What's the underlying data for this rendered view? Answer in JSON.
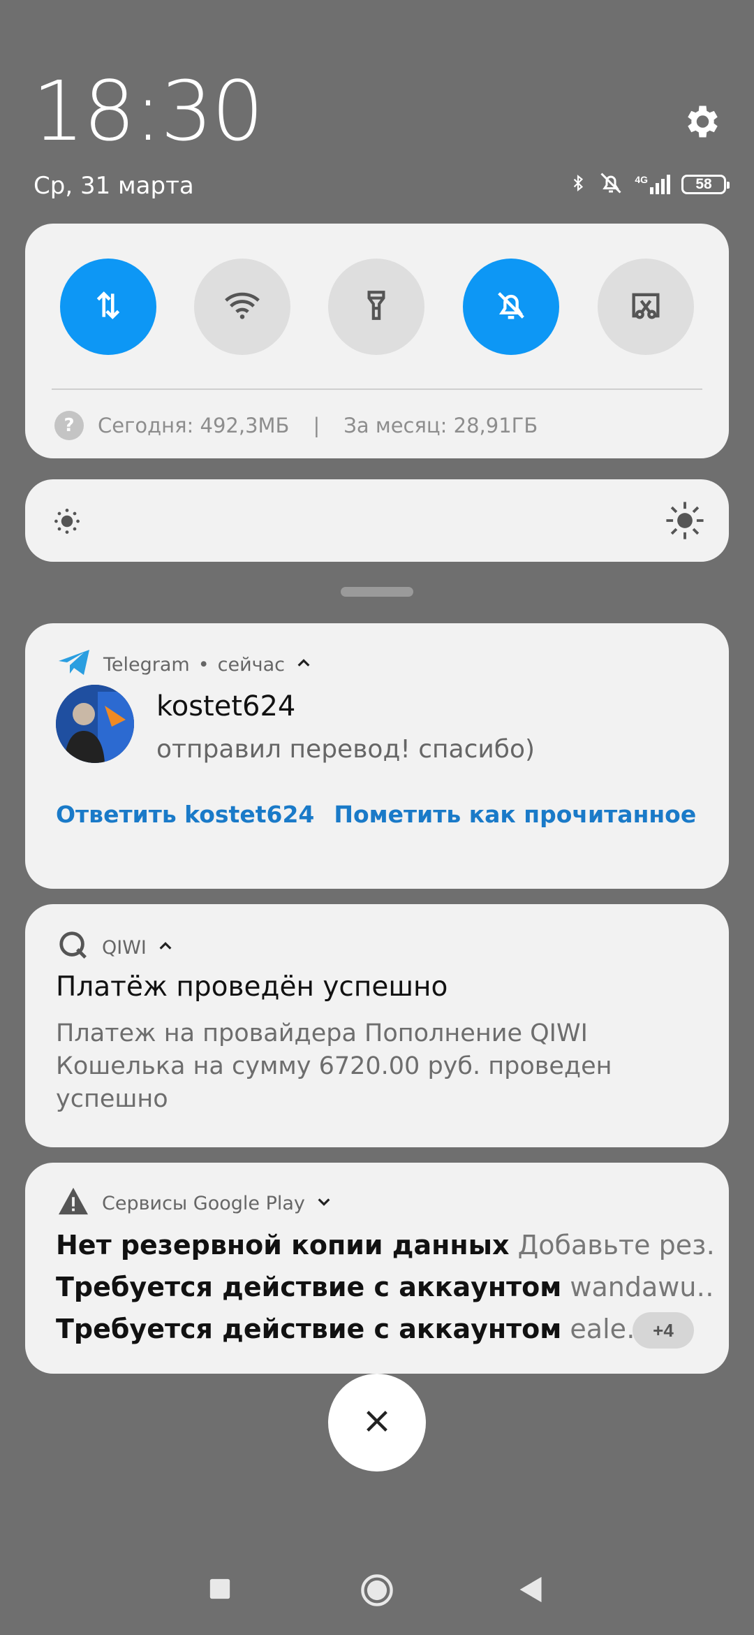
{
  "status": {
    "time": "18:30",
    "date": "Ср, 31 марта",
    "network_label": "4G",
    "battery_level": "58"
  },
  "quick_settings": {
    "toggles": [
      {
        "name": "mobile-data",
        "icon": "arrows-updown-icon",
        "active": true
      },
      {
        "name": "wifi",
        "icon": "wifi-icon",
        "active": false
      },
      {
        "name": "flashlight",
        "icon": "flashlight-icon",
        "active": false
      },
      {
        "name": "silent",
        "icon": "bell-off-icon",
        "active": true
      },
      {
        "name": "screenshot",
        "icon": "scissors-screen-icon",
        "active": false
      }
    ],
    "data_usage": {
      "today": "Сегодня: 492,3МБ",
      "separator": "|",
      "month": "За месяц: 28,91ГБ"
    }
  },
  "notifications": {
    "telegram": {
      "app": "Telegram",
      "time": "сейчас",
      "sender": "kostet624",
      "message": "отправил перевод! спасибо)",
      "actions": [
        "Ответить kostet624",
        "Пометить как прочитанное"
      ]
    },
    "qiwi": {
      "app": "QIWI",
      "title": "Платёж проведён успешно",
      "body": "Платеж на провайдера Пополнение QIWI Кошелька на сумму 6720.00 руб. проведен успешно"
    },
    "google_play": {
      "app": "Сервисы Google Play",
      "lines": [
        {
          "title": "Нет резервной копии данных",
          "text": "Добавьте рез…"
        },
        {
          "title": "Требуется действие с аккаунтом",
          "text": "wandawu…"
        },
        {
          "title": "Требуется действие с аккаунтом",
          "text": "eale…"
        }
      ],
      "more_count": "+4"
    }
  },
  "colors": {
    "accent": "#0d97f5",
    "link": "#1a7ac8",
    "background": "#6f6f6f"
  }
}
